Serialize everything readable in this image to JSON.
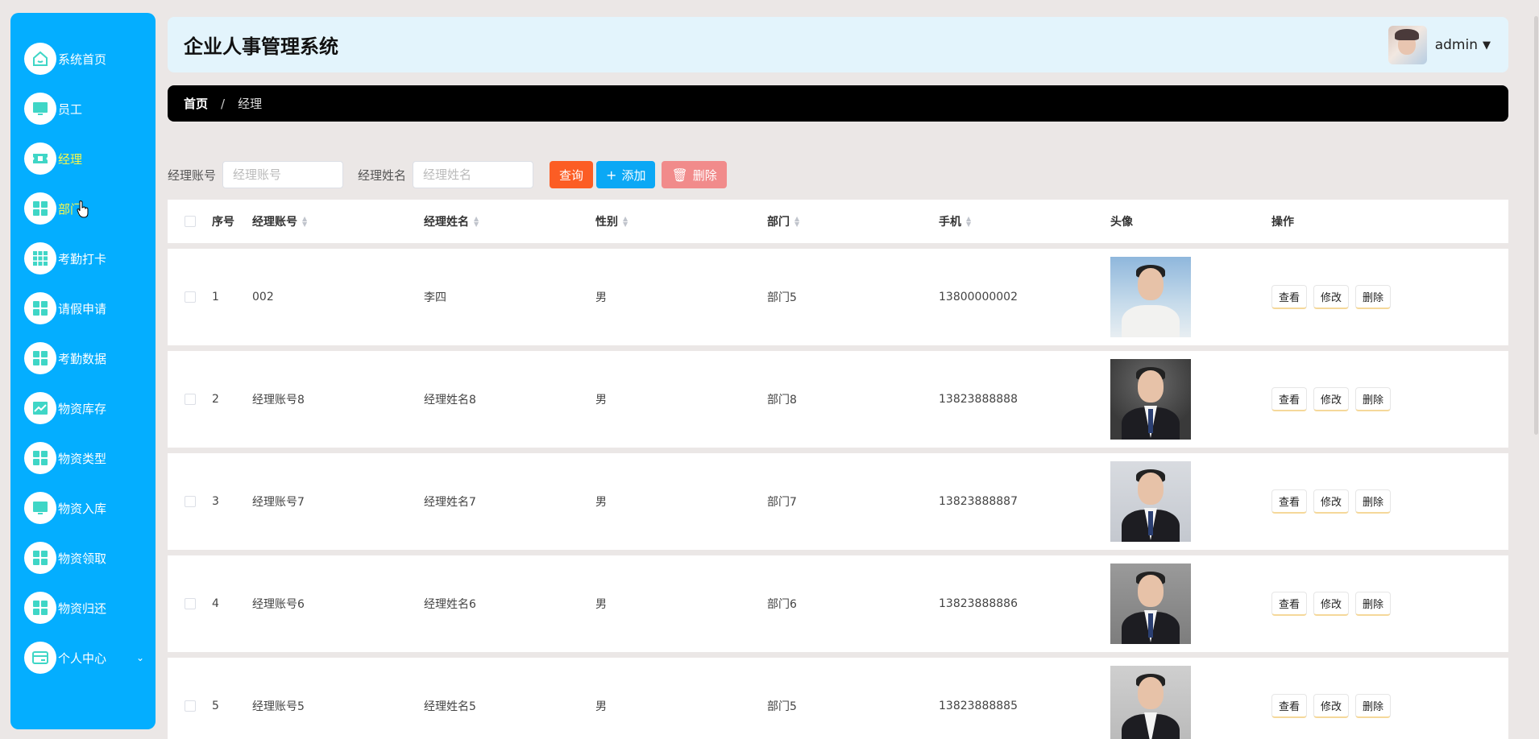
{
  "app": {
    "title": "企业人事管理系统",
    "user": "admin"
  },
  "sidebar": {
    "items": [
      {
        "label": "系统首页",
        "icon": "home-icon"
      },
      {
        "label": "员工",
        "icon": "monitor-icon"
      },
      {
        "label": "经理",
        "icon": "ticket-icon",
        "active": true
      },
      {
        "label": "部门",
        "icon": "grid-icon"
      },
      {
        "label": "考勤打卡",
        "icon": "grid9-icon"
      },
      {
        "label": "请假申请",
        "icon": "grid-icon"
      },
      {
        "label": "考勤数据",
        "icon": "grid-icon"
      },
      {
        "label": "物资库存",
        "icon": "chart-icon"
      },
      {
        "label": "物资类型",
        "icon": "grid-icon"
      },
      {
        "label": "物资入库",
        "icon": "monitor-icon"
      },
      {
        "label": "物资领取",
        "icon": "grid-icon"
      },
      {
        "label": "物资归还",
        "icon": "grid-icon"
      },
      {
        "label": "个人中心",
        "icon": "card-icon"
      }
    ]
  },
  "breadcrumb": {
    "home": "首页",
    "separator": "/",
    "current": "经理"
  },
  "search": {
    "account_label": "经理账号",
    "account_placeholder": "经理账号",
    "name_label": "经理姓名",
    "name_placeholder": "经理姓名",
    "query_label": "查询",
    "add_label": "添加",
    "delete_label": "删除"
  },
  "table": {
    "headers": {
      "idx": "序号",
      "account": "经理账号",
      "name": "经理姓名",
      "sex": "性别",
      "dept": "部门",
      "phone": "手机",
      "photo": "头像",
      "ops": "操作"
    },
    "actions": {
      "view": "查看",
      "edit": "修改",
      "delete": "删除"
    },
    "rows": [
      {
        "idx": "1",
        "account": "002",
        "name": "李四",
        "sex": "男",
        "dept": "部门5",
        "phone": "13800000002"
      },
      {
        "idx": "2",
        "account": "经理账号8",
        "name": "经理姓名8",
        "sex": "男",
        "dept": "部门8",
        "phone": "13823888888"
      },
      {
        "idx": "3",
        "account": "经理账号7",
        "name": "经理姓名7",
        "sex": "男",
        "dept": "部门7",
        "phone": "13823888887"
      },
      {
        "idx": "4",
        "account": "经理账号6",
        "name": "经理姓名6",
        "sex": "男",
        "dept": "部门6",
        "phone": "13823888886"
      },
      {
        "idx": "5",
        "account": "经理账号5",
        "name": "经理姓名5",
        "sex": "男",
        "dept": "部门5",
        "phone": "13823888885"
      }
    ]
  },
  "colors": {
    "sidebar": "#04aeff",
    "active_text": "#f7f74a",
    "query_button": "#fc5d24",
    "add_button": "#0ba8f5",
    "delete_button": "#f18b8b",
    "header_bg": "#e3f4fc",
    "breadcrumb_bg": "#000000"
  }
}
